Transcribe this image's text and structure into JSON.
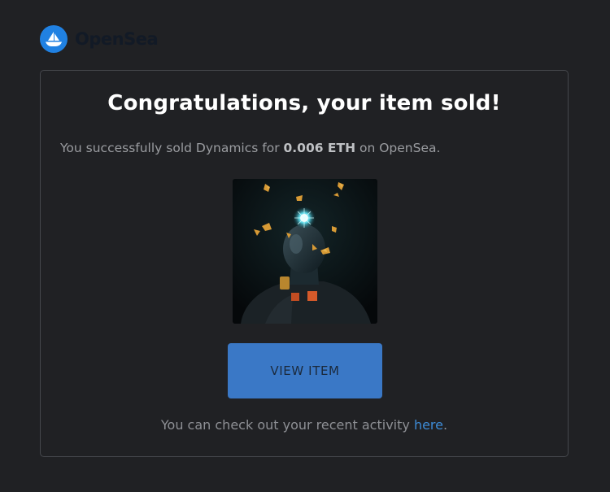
{
  "brand": {
    "name": "OpenSea",
    "logo_icon": "sailboat-icon",
    "logo_color": "#2081e2"
  },
  "notice": {
    "title": "Congratulations, your item sold!",
    "message_prefix": "You successfully sold Dynamics for ",
    "price": "0.006 ETH",
    "message_suffix": " on OpenSea.",
    "image_alt": "Dynamics NFT artwork"
  },
  "view_button": {
    "label": "VIEW ITEM",
    "color": "#3a78c6"
  },
  "footer": {
    "text_prefix": "You can check out your recent activity ",
    "link_label": "here",
    "text_suffix": ".",
    "link_color": "#3d8bd6"
  },
  "colors": {
    "background": "#202124",
    "card_border": "#45474c",
    "title": "#ffffff",
    "body_text": "#9a9ca0"
  }
}
